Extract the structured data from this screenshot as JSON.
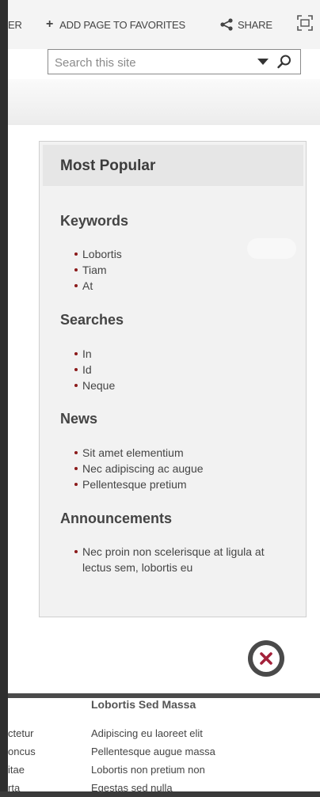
{
  "ribbon": {
    "partial_label": "ER",
    "add_favorites_label": "ADD PAGE TO FAVORITES",
    "share_label": "SHARE"
  },
  "search": {
    "placeholder": "Search this site"
  },
  "popular": {
    "title": "Most Popular",
    "sections": [
      {
        "title": "Keywords",
        "items": [
          "Lobortis",
          "Tiam",
          "At"
        ]
      },
      {
        "title": "Searches",
        "items": [
          "In",
          "Id",
          "Neque"
        ]
      },
      {
        "title": "News",
        "items": [
          "Sit amet elementium",
          "Nec adipiscing ac augue",
          "Pellentesque pretium"
        ]
      },
      {
        "title": "Announcements",
        "items": [
          "Nec proin non scelerisque at ligula at lectus sem, lobortis eu"
        ]
      }
    ]
  },
  "bottom": {
    "heading": "Lobortis Sed Massa",
    "left_column": [
      "ctetur",
      "oncus",
      "itae",
      "rta"
    ],
    "right_column": [
      "Adipiscing eu laoreet elit",
      "Pellentesque augue massa",
      "Lobortis non pretium non",
      "Egestas sed nulla"
    ]
  },
  "icons": {
    "add": "plus-icon",
    "share": "share-icon",
    "focus": "focus-mode-icon",
    "dropdown": "caret-down-icon",
    "search": "search-icon",
    "close": "close-icon"
  },
  "colors": {
    "bullet": "#8b1a1a",
    "close_x": "#a3213a"
  }
}
